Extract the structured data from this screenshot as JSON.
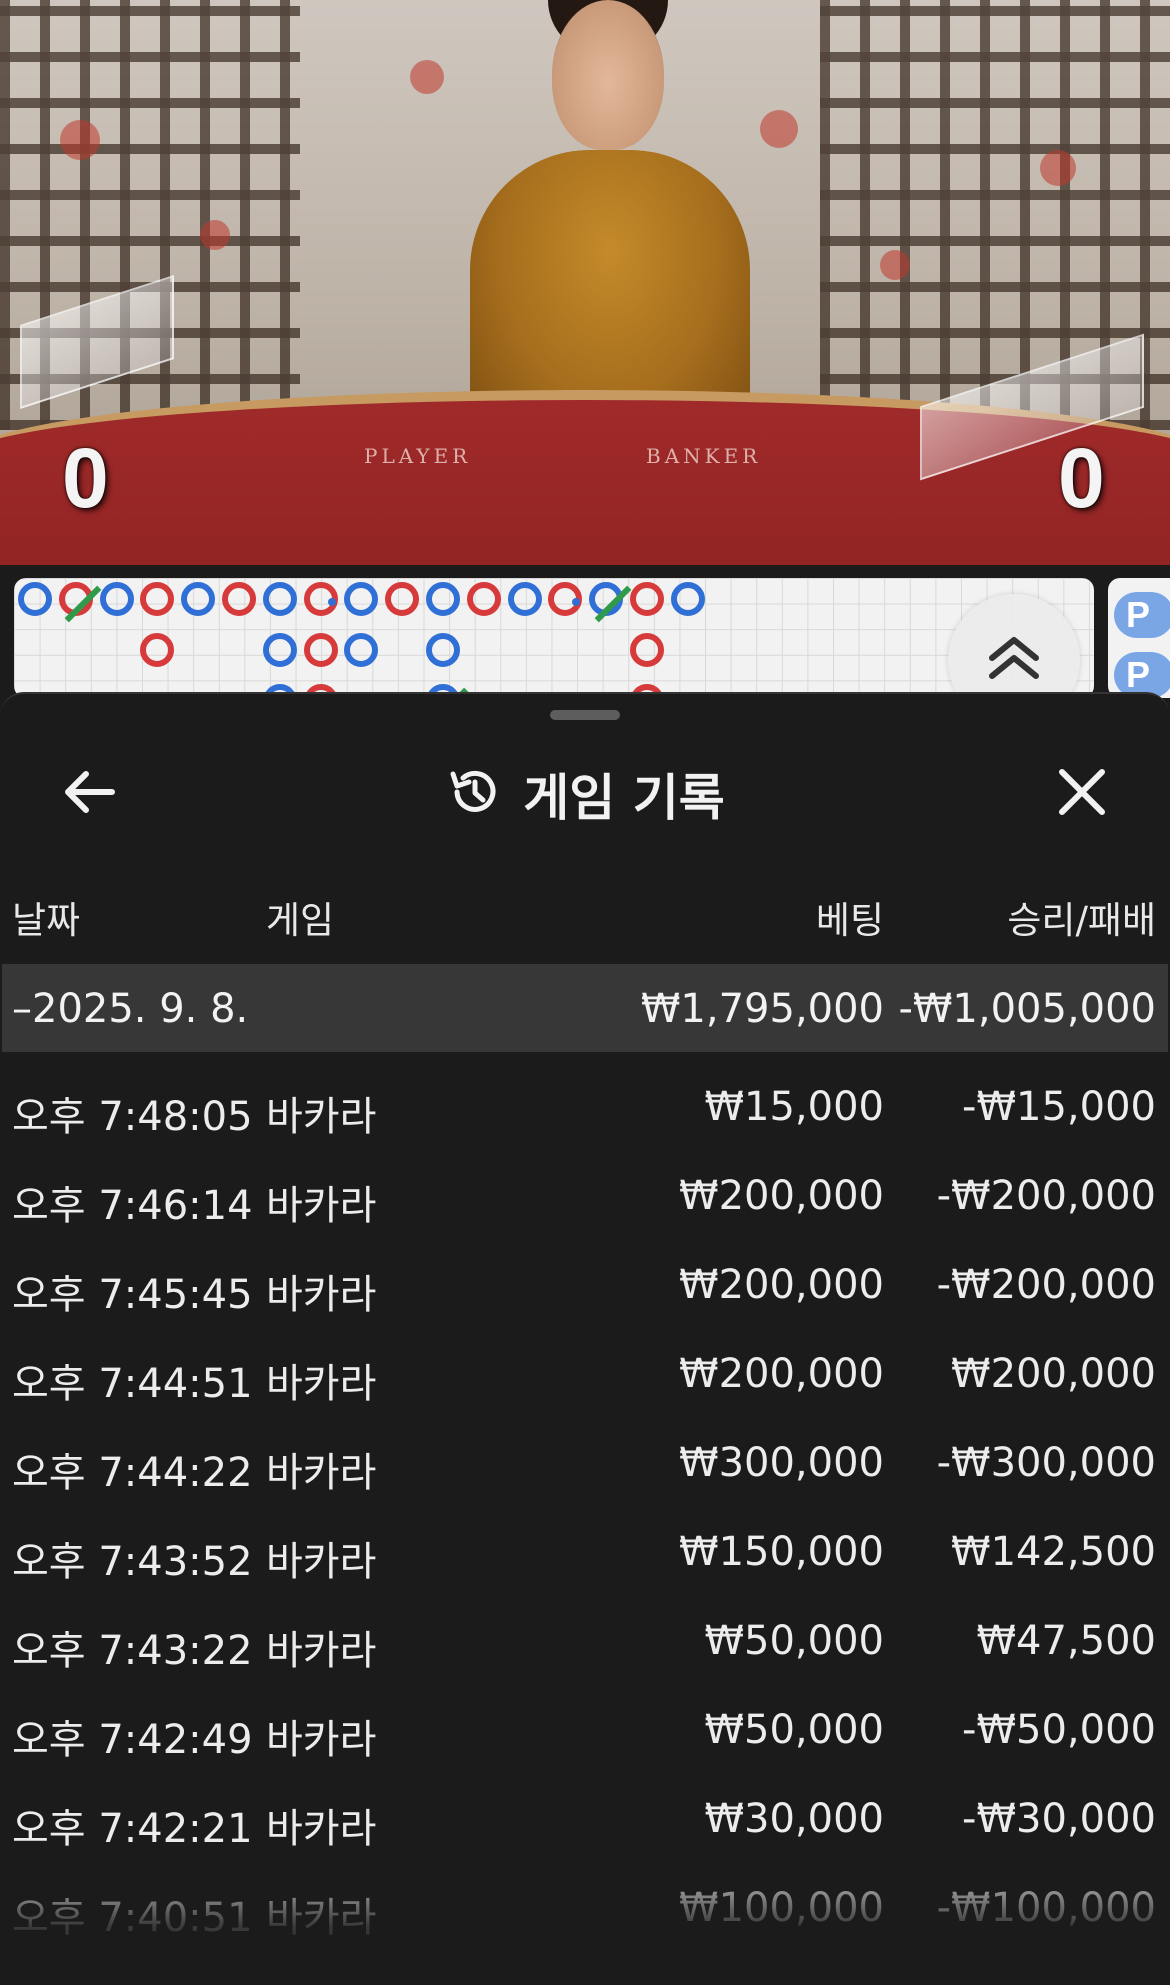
{
  "video": {
    "player_label": "PLAYER",
    "banker_label": "BANKER",
    "player_score": "0",
    "banker_score": "0"
  },
  "road": {
    "side_pills": [
      "P",
      "P"
    ],
    "beads": [
      {
        "col": 0,
        "row": 0,
        "color": "blue"
      },
      {
        "col": 1,
        "row": 0,
        "color": "red",
        "tie": true
      },
      {
        "col": 2,
        "row": 0,
        "color": "blue"
      },
      {
        "col": 3,
        "row": 0,
        "color": "red"
      },
      {
        "col": 3,
        "row": 1,
        "color": "red"
      },
      {
        "col": 4,
        "row": 0,
        "color": "blue"
      },
      {
        "col": 5,
        "row": 0,
        "color": "red"
      },
      {
        "col": 6,
        "row": 0,
        "color": "blue"
      },
      {
        "col": 6,
        "row": 1,
        "color": "blue"
      },
      {
        "col": 6,
        "row": 2,
        "color": "blue"
      },
      {
        "col": 7,
        "row": 0,
        "color": "red",
        "pair": true
      },
      {
        "col": 7,
        "row": 1,
        "color": "red"
      },
      {
        "col": 7,
        "row": 2,
        "color": "red"
      },
      {
        "col": 8,
        "row": 0,
        "color": "blue"
      },
      {
        "col": 8,
        "row": 1,
        "color": "blue"
      },
      {
        "col": 9,
        "row": 0,
        "color": "red"
      },
      {
        "col": 10,
        "row": 0,
        "color": "blue"
      },
      {
        "col": 10,
        "row": 1,
        "color": "blue"
      },
      {
        "col": 10,
        "row": 2,
        "color": "blue",
        "tie": true
      },
      {
        "col": 11,
        "row": 0,
        "color": "red"
      },
      {
        "col": 12,
        "row": 0,
        "color": "blue"
      },
      {
        "col": 13,
        "row": 0,
        "color": "red",
        "pair": true
      },
      {
        "col": 14,
        "row": 0,
        "color": "blue",
        "tie": true
      },
      {
        "col": 15,
        "row": 0,
        "color": "red"
      },
      {
        "col": 15,
        "row": 1,
        "color": "red"
      },
      {
        "col": 15,
        "row": 2,
        "color": "red"
      },
      {
        "col": 16,
        "row": 0,
        "color": "blue"
      }
    ]
  },
  "sheet": {
    "title": "게임 기록",
    "icons": {
      "back": "arrow-left-icon",
      "history": "history-icon",
      "close": "close-icon",
      "expand": "chevron-double-up-icon"
    },
    "columns": {
      "date": "날짜",
      "game": "게임",
      "bet": "베팅",
      "win_loss": "승리/패배"
    },
    "group": {
      "date": "–2025. 9. 8.",
      "bet": "₩1,795,000",
      "win_loss": "-₩1,005,000"
    },
    "rows": [
      {
        "time": "오후 7:48:05",
        "game": "바카라",
        "bet": "₩15,000",
        "win_loss": "-₩15,000"
      },
      {
        "time": "오후 7:46:14",
        "game": "바카라",
        "bet": "₩200,000",
        "win_loss": "-₩200,000"
      },
      {
        "time": "오후 7:45:45",
        "game": "바카라",
        "bet": "₩200,000",
        "win_loss": "-₩200,000"
      },
      {
        "time": "오후 7:44:51",
        "game": "바카라",
        "bet": "₩200,000",
        "win_loss": "₩200,000"
      },
      {
        "time": "오후 7:44:22",
        "game": "바카라",
        "bet": "₩300,000",
        "win_loss": "-₩300,000"
      },
      {
        "time": "오후 7:43:52",
        "game": "바카라",
        "bet": "₩150,000",
        "win_loss": "₩142,500"
      },
      {
        "time": "오후 7:43:22",
        "game": "바카라",
        "bet": "₩50,000",
        "win_loss": "₩47,500"
      },
      {
        "time": "오후 7:42:49",
        "game": "바카라",
        "bet": "₩50,000",
        "win_loss": "-₩50,000"
      },
      {
        "time": "오후 7:42:21",
        "game": "바카라",
        "bet": "₩30,000",
        "win_loss": "-₩30,000"
      },
      {
        "time": "오후 7:40:51",
        "game": "바카라",
        "bet": "₩100,000",
        "win_loss": "-₩100,000"
      }
    ]
  }
}
